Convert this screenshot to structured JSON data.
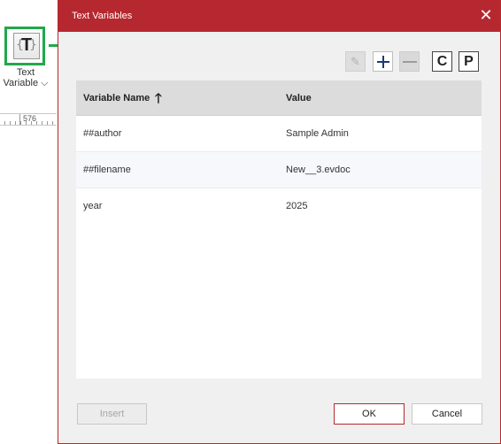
{
  "ribbon": {
    "text_variable_button": {
      "line1": "Text",
      "line2": "Variable",
      "chevron": "⌵"
    },
    "ruler_value": "576"
  },
  "dialog": {
    "title": "Text Variables",
    "close_glyph": "✕",
    "toolbar": {
      "edit_glyph": "✎",
      "copy_label": "C",
      "paste_label": "P"
    },
    "table": {
      "columns": [
        "Variable Name",
        "Value"
      ],
      "sort_glyph": "🡑",
      "rows": [
        {
          "name": "##author",
          "value": "Sample Admin"
        },
        {
          "name": "##filename",
          "value": "New__3.evdoc"
        },
        {
          "name": "year",
          "value": "2025"
        }
      ]
    },
    "buttons": {
      "insert": "Insert",
      "ok": "OK",
      "cancel": "Cancel"
    }
  },
  "colors": {
    "dialog_accent": "#b5282f",
    "highlight_green": "#21a84a",
    "header_gray": "#dcdcdc",
    "plus_blue": "#1c3b73"
  },
  "icons": {
    "text_variable": "text-variable-icon",
    "arrow": "green-arrow-icon",
    "edit": "pencil-icon",
    "add": "plus-icon",
    "remove": "minus-icon",
    "sort": "sort-up-arrow-icon",
    "close": "close-icon"
  }
}
